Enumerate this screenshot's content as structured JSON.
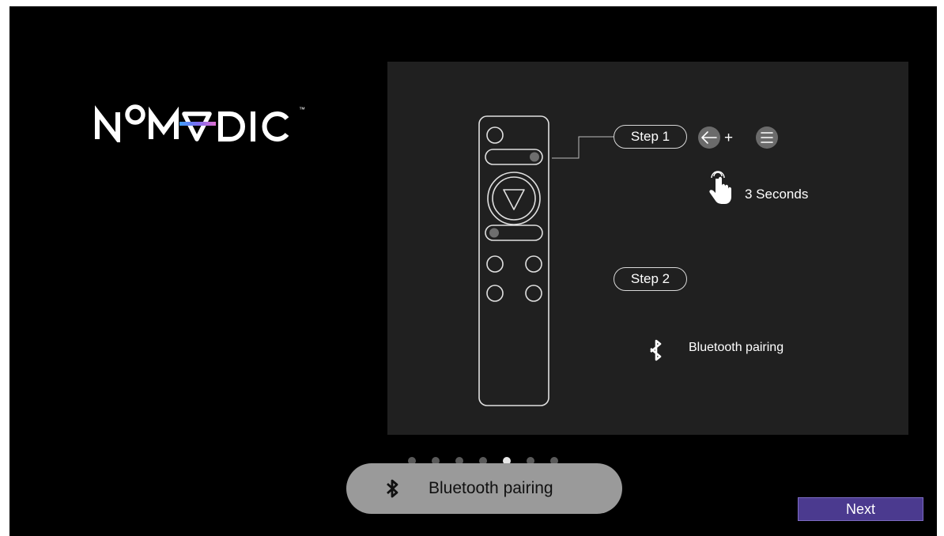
{
  "brand": {
    "logo_text": "NOMADIC",
    "trademark": "™"
  },
  "guide": {
    "step1_label": "Step 1",
    "step1_keys": [
      "back-arrow-icon",
      "menu-icon"
    ],
    "plus": "+",
    "hold_text": "3  Seconds",
    "step2_label": "Step 2",
    "step2_action": "Bluetooth pairing"
  },
  "pagination": {
    "total": 7,
    "active_index": 4
  },
  "toast": {
    "icon": "bluetooth-icon",
    "label": "Bluetooth pairing"
  },
  "actions": {
    "next_label": "Next"
  },
  "colors": {
    "screen_bg": "#000000",
    "panel_bg": "#202020",
    "next_button": "#4b3a8f",
    "toast_bg": "#9a9a9a",
    "logo_accent": "#7c6cf0"
  }
}
